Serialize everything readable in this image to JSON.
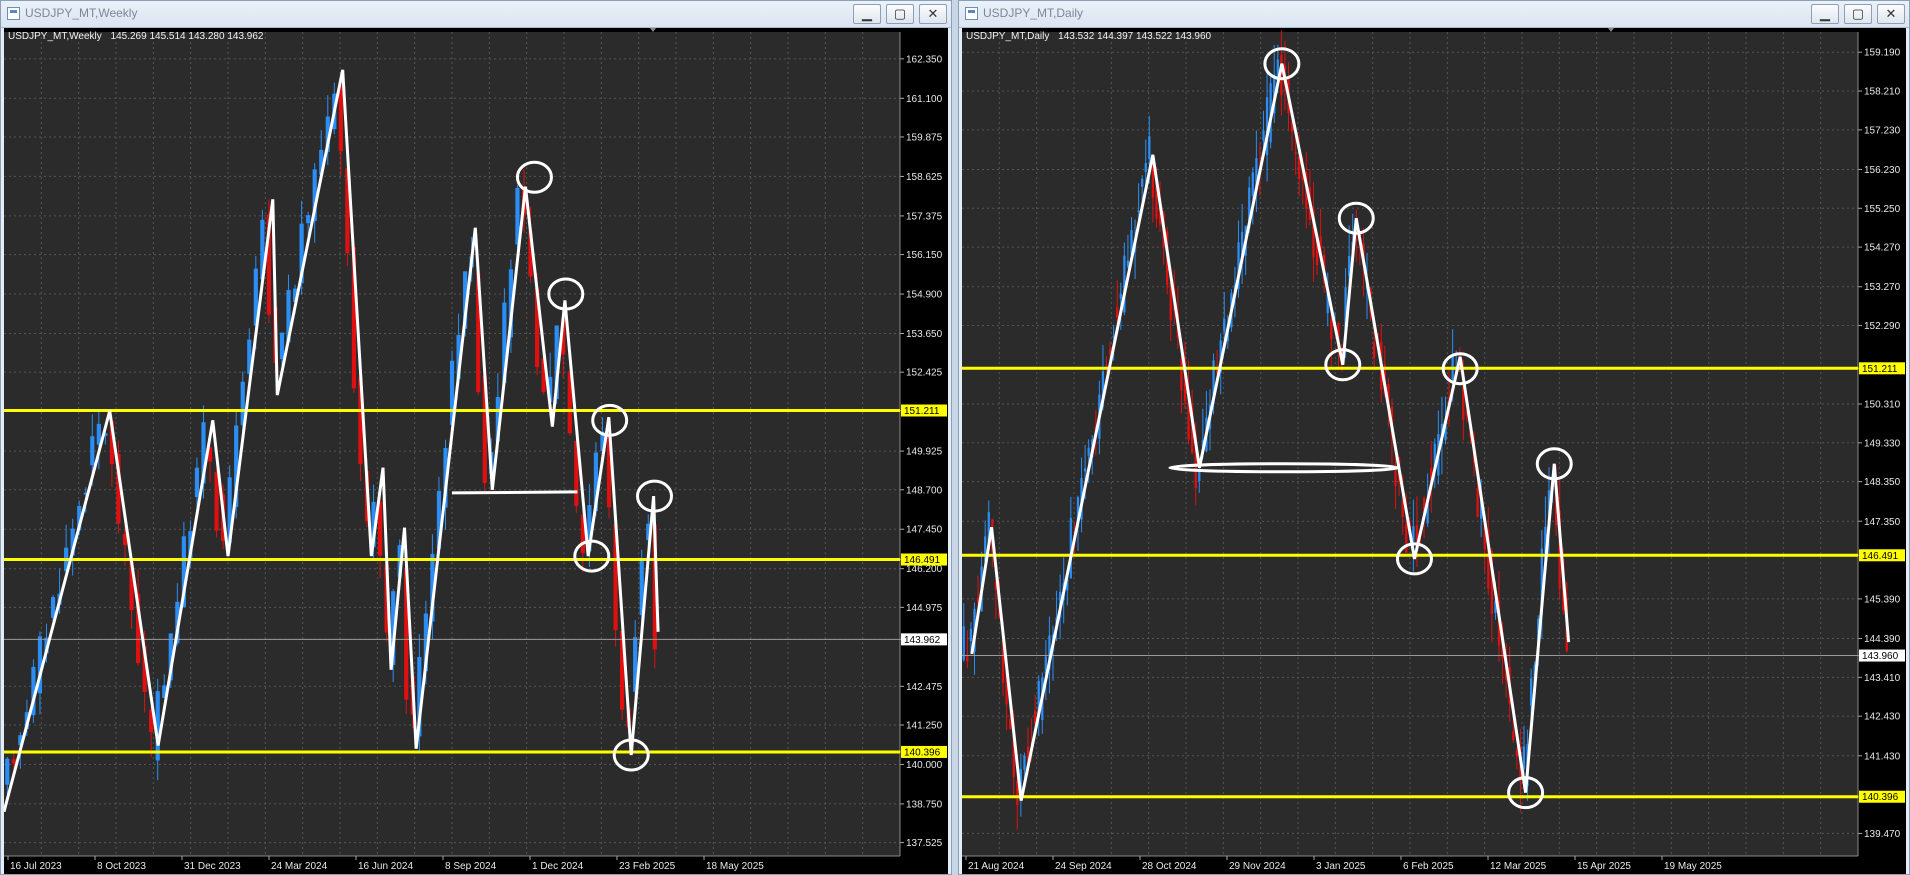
{
  "windows": [
    {
      "id": "weekly",
      "title": "USDJPY_MT,Weekly",
      "header": {
        "symbol": "USDJPY_MT,Weekly",
        "open": "145.269",
        "high": "145.514",
        "low": "143.280",
        "close": "143.962"
      },
      "price_axis": {
        "ticks": [
          "162.350",
          "161.100",
          "159.875",
          "158.625",
          "157.375",
          "156.150",
          "154.900",
          "153.650",
          "152.425",
          "151.211",
          "149.925",
          "148.700",
          "147.450",
          "146.491",
          "146.200",
          "144.975",
          "143.962",
          "142.475",
          "141.250",
          "140.396",
          "140.000",
          "138.750",
          "137.525"
        ],
        "min": 137.1,
        "max": 163.2
      },
      "time_axis": {
        "labels": [
          "16 Jul 2023",
          "8 Oct 2023",
          "31 Dec 2023",
          "24 Mar 2024",
          "16 Jun 2024",
          "8 Sep 2024",
          "1 Dec 2024",
          "23 Feb 2025",
          "18 May 2025"
        ]
      },
      "levels": [
        {
          "price": 151.211,
          "label": "151.211",
          "color": "#ffff00"
        },
        {
          "price": 146.491,
          "label": "146.491",
          "color": "#ffff00"
        },
        {
          "price": 140.396,
          "label": "140.396",
          "color": "#ffff00"
        }
      ],
      "current_price": {
        "price": 143.962,
        "label": "143.962"
      },
      "zigzag": [
        [
          0.0,
          138.5
        ],
        [
          0.118,
          151.2
        ],
        [
          0.172,
          140.6
        ],
        [
          0.233,
          150.9
        ],
        [
          0.25,
          146.6
        ],
        [
          0.3,
          157.9
        ],
        [
          0.305,
          151.7
        ],
        [
          0.378,
          162.0
        ],
        [
          0.41,
          146.6
        ],
        [
          0.423,
          149.4
        ],
        [
          0.432,
          143.0
        ],
        [
          0.447,
          147.5
        ],
        [
          0.46,
          140.5
        ],
        [
          0.526,
          157.0
        ],
        [
          0.545,
          148.7
        ],
        [
          0.582,
          158.3
        ],
        [
          0.612,
          150.7
        ],
        [
          0.626,
          154.7
        ],
        [
          0.652,
          146.6
        ],
        [
          0.675,
          151.0
        ],
        [
          0.7,
          140.3
        ],
        [
          0.725,
          148.5
        ],
        [
          0.73,
          144.2
        ]
      ],
      "trendline_flat": {
        "x1": 0.5,
        "x2": 0.64,
        "price": 148.6
      },
      "circles": [
        {
          "x": 0.592,
          "price": 158.6
        },
        {
          "x": 0.627,
          "price": 154.9
        },
        {
          "x": 0.676,
          "price": 150.9
        },
        {
          "x": 0.656,
          "price": 146.6
        },
        {
          "x": 0.726,
          "price": 148.5
        },
        {
          "x": 0.7,
          "price": 140.3
        }
      ]
    },
    {
      "id": "daily",
      "title": "USDJPY_MT,Daily",
      "header": {
        "symbol": "USDJPY_MT,Daily",
        "open": "143.532",
        "high": "144.397",
        "low": "143.522",
        "close": "143.960"
      },
      "price_axis": {
        "ticks": [
          "159.190",
          "158.210",
          "157.230",
          "156.230",
          "155.250",
          "154.270",
          "153.270",
          "152.290",
          "151.211",
          "150.310",
          "149.330",
          "148.350",
          "147.350",
          "146.491",
          "145.390",
          "144.390",
          "143.960",
          "143.410",
          "142.430",
          "141.430",
          "140.396",
          "139.470"
        ],
        "min": 138.9,
        "max": 159.7
      },
      "time_axis": {
        "labels": [
          "21 Aug 2024",
          "24 Sep 2024",
          "28 Oct 2024",
          "29 Nov 2024",
          "3 Jan 2025",
          "6 Feb 2025",
          "12 Mar 2025",
          "15 Apr 2025",
          "19 May 2025"
        ]
      },
      "levels": [
        {
          "price": 151.211,
          "label": "151.211",
          "color": "#ffff00"
        },
        {
          "price": 146.491,
          "label": "146.491",
          "color": "#ffff00"
        },
        {
          "price": 140.396,
          "label": "140.396",
          "color": "#ffff00"
        }
      ],
      "current_price": {
        "price": 143.96,
        "label": "143.960"
      },
      "zigzag": [
        [
          0.011,
          144.0
        ],
        [
          0.033,
          147.2
        ],
        [
          0.066,
          140.3
        ],
        [
          0.213,
          156.6
        ],
        [
          0.265,
          148.7
        ],
        [
          0.357,
          158.9
        ],
        [
          0.425,
          151.3
        ],
        [
          0.44,
          155.0
        ],
        [
          0.505,
          146.4
        ],
        [
          0.556,
          151.5
        ],
        [
          0.629,
          140.5
        ],
        [
          0.661,
          148.8
        ],
        [
          0.677,
          144.3
        ]
      ],
      "trendline_flat": {
        "x1": 0.232,
        "x2": 0.487,
        "price": 148.7
      },
      "circles": [
        {
          "x": 0.357,
          "price": 158.9
        },
        {
          "x": 0.44,
          "price": 155.0
        },
        {
          "x": 0.425,
          "price": 151.3
        },
        {
          "x": 0.556,
          "price": 151.2
        },
        {
          "x": 0.505,
          "price": 146.4
        },
        {
          "x": 0.661,
          "price": 148.8
        },
        {
          "x": 0.629,
          "price": 140.5
        }
      ]
    }
  ]
}
